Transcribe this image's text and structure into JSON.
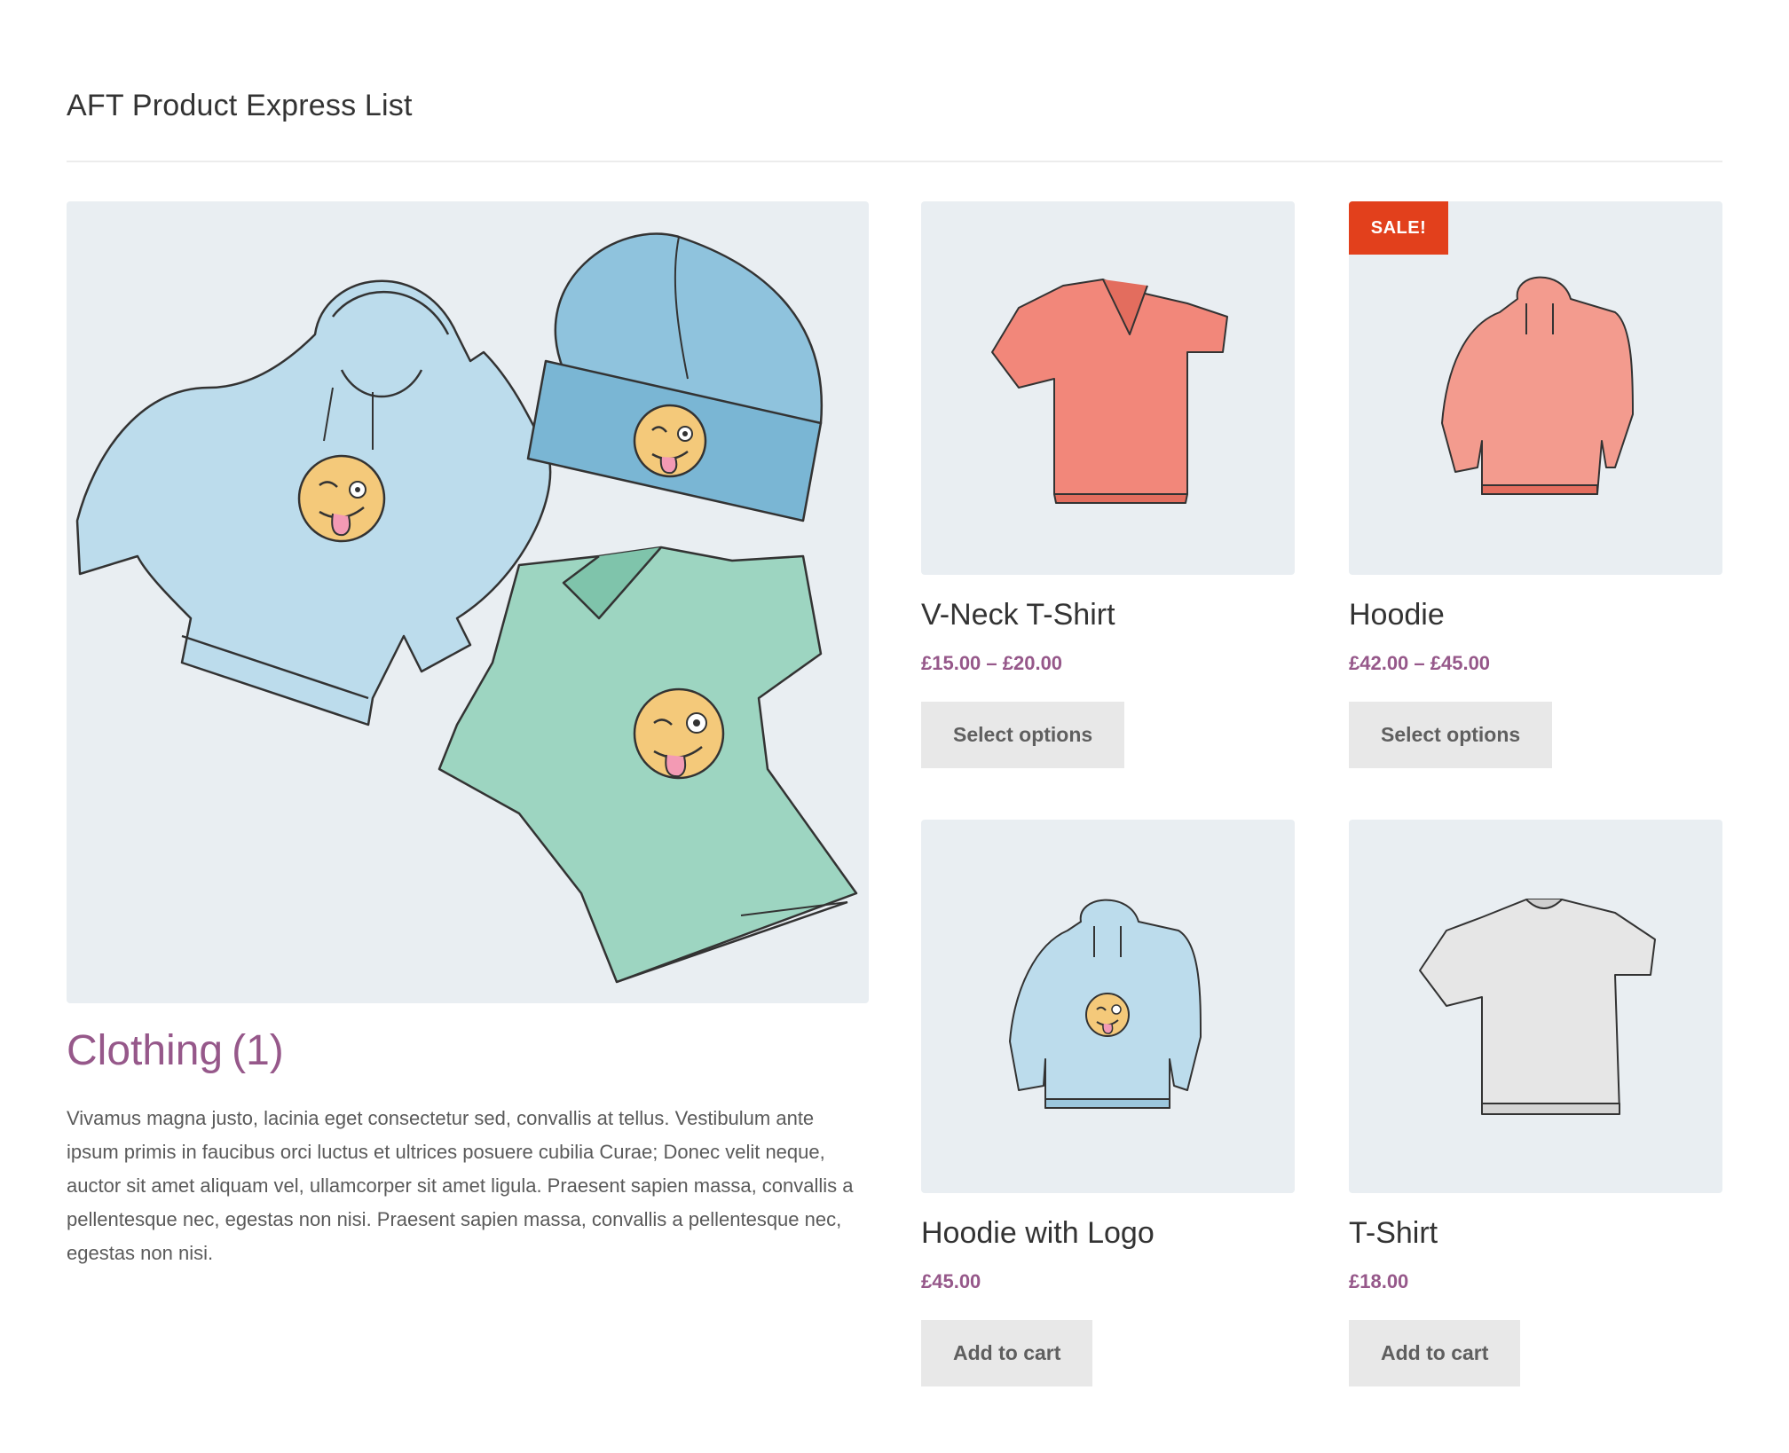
{
  "page": {
    "title": "AFT Product Express List"
  },
  "category": {
    "name": "Clothing",
    "count": "(1)",
    "description": "Vivamus magna justo, lacinia eget consectetur sed, convallis at tellus. Vestibulum ante ipsum primis in faucibus orci luctus et ultrices posuere cubilia Curae; Donec velit neque, auctor sit amet aliquam vel, ullamcorper sit amet ligula. Praesent sapien massa, convallis a pellentesque nec, egestas non nisi. Praesent sapien massa, convallis a pellentesque nec, egestas non nisi."
  },
  "products": [
    {
      "name": "V-Neck T-Shirt",
      "price": "£15.00 – £20.00",
      "button": "Select options",
      "image": "coral-vneck-tshirt"
    },
    {
      "name": "Hoodie",
      "price": "£42.00 – £45.00",
      "button": "Select options",
      "badge": "SALE!",
      "image": "coral-hoodie"
    },
    {
      "name": "Hoodie with Logo",
      "price": "£45.00",
      "button": "Add to cart",
      "image": "blue-hoodie-with-logo"
    },
    {
      "name": "T-Shirt",
      "price": "£18.00",
      "button": "Add to cart",
      "image": "grey-tshirt"
    }
  ],
  "colors": {
    "accent": "#96588a",
    "sale": "#e2401c",
    "image_bg": "#e9eef2",
    "button_bg": "#e8e8e8"
  }
}
